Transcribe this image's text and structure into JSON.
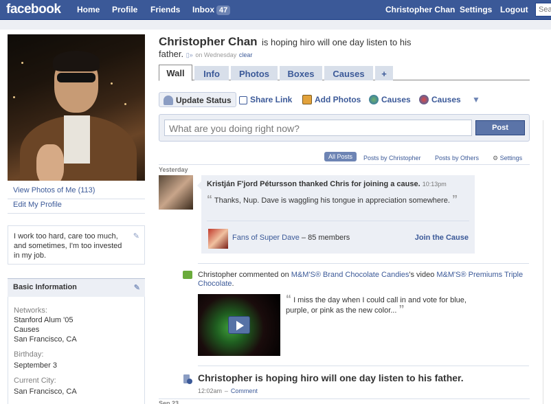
{
  "topbar": {
    "logo": "facebook",
    "nav": [
      "Home",
      "Profile",
      "Friends",
      "Inbox"
    ],
    "inbox_count": "47",
    "right_nav": [
      "Christopher Chan",
      "Settings",
      "Logout"
    ],
    "search_placeholder": "Sea"
  },
  "sidebar": {
    "view_photos": "View Photos of Me (113)",
    "edit_profile": "Edit My Profile",
    "bio": "I work too hard, care too much, and sometimes, I'm too invested in my job.",
    "basic_info_title": "Basic Information",
    "info": {
      "networks_label": "Networks:",
      "networks": [
        "Stanford Alum '05",
        "Causes",
        "San Francisco, CA"
      ],
      "birthday_label": "Birthday:",
      "birthday": "September 3",
      "city_label": "Current City:",
      "city": "San Francisco, CA"
    }
  },
  "profile": {
    "name": "Christopher Chan",
    "status_line1": "is hoping hiro will one day listen to his",
    "status_line2": "father.",
    "status_time": "on Wednesday",
    "status_clear": "clear"
  },
  "tabs": [
    "Wall",
    "Info",
    "Photos",
    "Boxes",
    "Causes",
    "+"
  ],
  "publisher": {
    "buttons": [
      "Update Status",
      "Share Link",
      "Add Photos",
      "Causes",
      "Causes"
    ],
    "placeholder": "What are you doing right now?",
    "post_label": "Post"
  },
  "filters": [
    "All Posts",
    "Posts by Christopher",
    "Posts by Others",
    "Settings"
  ],
  "feed": {
    "yesterday_label": "Yesterday",
    "story1": {
      "title": "Kristján F'jord Pétursson thanked Chris for joining a cause.",
      "time": "10:13pm",
      "quote": "Thanks, Nup. Dave is waggling his tongue in appreciation somewhere.",
      "cause_name": "Fans of Super Dave",
      "cause_sep": "–",
      "cause_members": "85 members",
      "join_label": "Join the Cause"
    },
    "story2": {
      "actor": "Christopher",
      "verb": "commented on",
      "brand": "M&M'S® Brand Chocolate Candies",
      "mid": "'s video",
      "video_title": "M&M'S® Premiums Triple Chocolate",
      "end": ".",
      "quote": "I miss the day when I could call in and vote for blue, purple, or pink as the new color..."
    },
    "story3": {
      "text": "Christopher is hoping hiro will one day listen to his father.",
      "time": "12:02am",
      "dash": "–",
      "comment_label": "Comment"
    },
    "date2_label": "Sep 23"
  },
  "colors": {
    "brand": "#3b5998",
    "tab_bg": "#d8dfea",
    "post_button": "#5b74a8"
  },
  "icons": [
    "pencil-icon",
    "status-person-icon",
    "share-link-icon",
    "add-photos-icon",
    "causes-globe-icon",
    "causes-heart-icon",
    "dropdown-arrow-icon",
    "gear-icon",
    "comment-bubble-icon",
    "status-update-icon",
    "play-icon",
    "mobile-icon"
  ]
}
